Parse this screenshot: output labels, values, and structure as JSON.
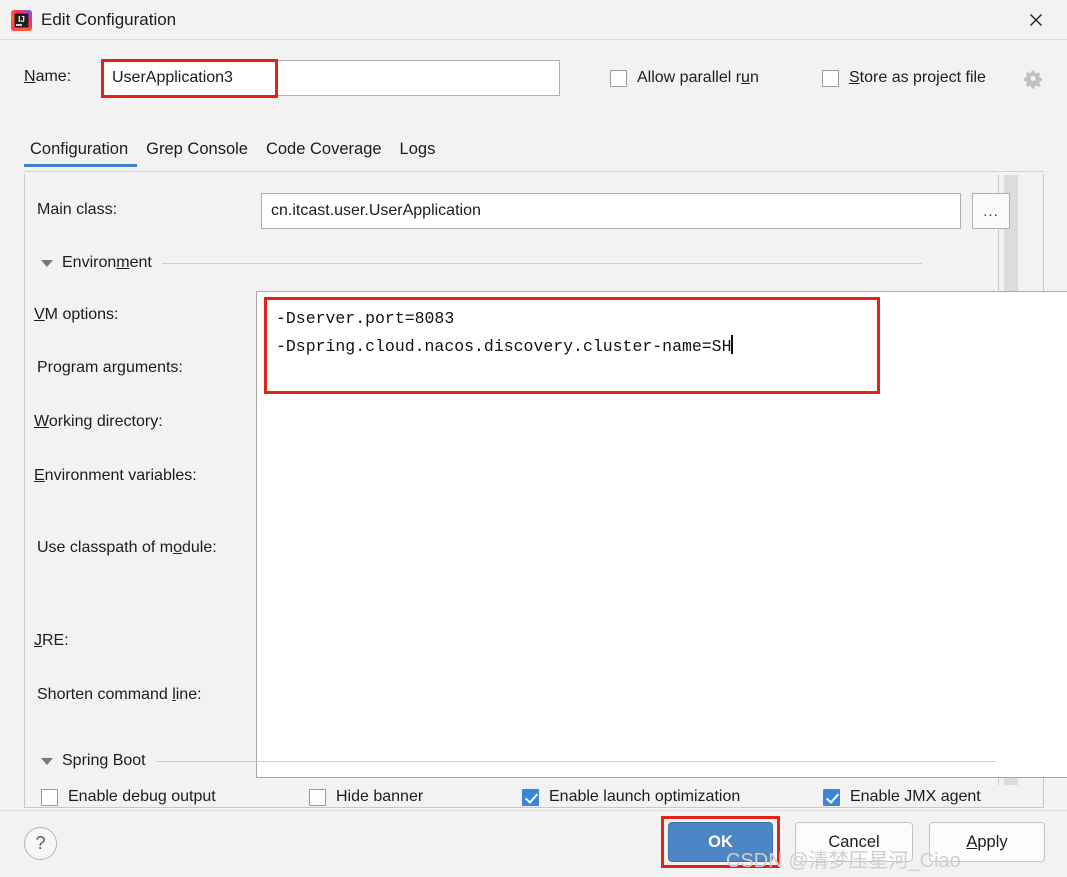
{
  "window": {
    "title": "Edit Configuration",
    "app_icon": "intellij-idea-icon",
    "close_icon": "close-icon"
  },
  "name_row": {
    "label_prefix": "N",
    "label_rest": "ame:",
    "value": "UserApplication3",
    "allow_parallel_run": {
      "label_a": "Allow parallel r",
      "label_mnemonic": "u",
      "label_b": "n",
      "checked": false
    },
    "store_as_project_file": {
      "label_mnemonic": "S",
      "label_rest": "tore as project file",
      "checked": false
    },
    "gear_icon": "gear-dropdown-icon"
  },
  "tabs": [
    {
      "label": "Configuration",
      "active": true
    },
    {
      "label": "Grep Console",
      "active": false
    },
    {
      "label": "Code Coverage",
      "active": false
    },
    {
      "label": "Logs",
      "active": false
    }
  ],
  "fields": {
    "main_class": {
      "label": "Main class:",
      "value": "cn.itcast.user.UserApplication",
      "browse_label": "..."
    },
    "vm_options": {
      "label_mnemonic": "V",
      "label_rest": "M options:",
      "line1": "-Dserver.port=8083",
      "line2": "-Dspring.cloud.nacos.discovery.cluster-name=SH"
    },
    "program_arguments": {
      "label_a": "Program ar",
      "label_mnemonic": "g",
      "label_b": "uments:"
    },
    "working_directory": {
      "label_mnemonic": "W",
      "label_rest": "orking directory:"
    },
    "environment_variables": {
      "label_mnemonic": "E",
      "label_rest": "nvironment variables:"
    },
    "use_classpath_of_module": {
      "label_a": "Use classpath of m",
      "label_mnemonic": "o",
      "label_b": "dule:"
    },
    "jre": {
      "label_mnemonic": "J",
      "label_rest": "RE:"
    },
    "shorten_command_line": {
      "label_a": "Shorten command ",
      "label_mnemonic": "l",
      "label_b": "ine:"
    }
  },
  "sections": {
    "environment": {
      "title_a": "Environ",
      "title_mnemonic": "m",
      "title_b": "ent",
      "expanded": true
    },
    "spring_boot": {
      "title": "Spring Boot",
      "expanded": true
    }
  },
  "spring_boot_options": [
    {
      "label": "Enable debug output",
      "checked": false
    },
    {
      "label": "Hide banner",
      "checked": false
    },
    {
      "label": "Enable launch optimization",
      "checked": true
    },
    {
      "label": "Enable JMX agent",
      "checked": true
    }
  ],
  "buttons": {
    "help": "?",
    "ok": "OK",
    "cancel": "Cancel",
    "apply_mnemonic": "A",
    "apply_rest": "pply"
  },
  "watermark": "CSDN @清梦压星河_Ciao",
  "colors": {
    "accent_blue": "#4083c9",
    "ok_button": "#4d86c4",
    "checkbox_checked": "#3d85d8",
    "annotation_red": "#e2231a",
    "dialog_bg": "#f2f2f2"
  }
}
